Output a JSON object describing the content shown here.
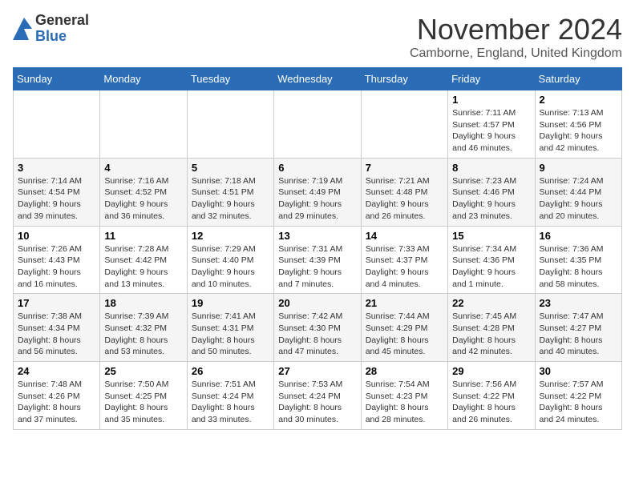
{
  "logo": {
    "general": "General",
    "blue": "Blue"
  },
  "header": {
    "month": "November 2024",
    "location": "Camborne, England, United Kingdom"
  },
  "weekdays": [
    "Sunday",
    "Monday",
    "Tuesday",
    "Wednesday",
    "Thursday",
    "Friday",
    "Saturday"
  ],
  "weeks": [
    [
      {
        "day": "",
        "info": ""
      },
      {
        "day": "",
        "info": ""
      },
      {
        "day": "",
        "info": ""
      },
      {
        "day": "",
        "info": ""
      },
      {
        "day": "",
        "info": ""
      },
      {
        "day": "1",
        "info": "Sunrise: 7:11 AM\nSunset: 4:57 PM\nDaylight: 9 hours and 46 minutes."
      },
      {
        "day": "2",
        "info": "Sunrise: 7:13 AM\nSunset: 4:56 PM\nDaylight: 9 hours and 42 minutes."
      }
    ],
    [
      {
        "day": "3",
        "info": "Sunrise: 7:14 AM\nSunset: 4:54 PM\nDaylight: 9 hours and 39 minutes."
      },
      {
        "day": "4",
        "info": "Sunrise: 7:16 AM\nSunset: 4:52 PM\nDaylight: 9 hours and 36 minutes."
      },
      {
        "day": "5",
        "info": "Sunrise: 7:18 AM\nSunset: 4:51 PM\nDaylight: 9 hours and 32 minutes."
      },
      {
        "day": "6",
        "info": "Sunrise: 7:19 AM\nSunset: 4:49 PM\nDaylight: 9 hours and 29 minutes."
      },
      {
        "day": "7",
        "info": "Sunrise: 7:21 AM\nSunset: 4:48 PM\nDaylight: 9 hours and 26 minutes."
      },
      {
        "day": "8",
        "info": "Sunrise: 7:23 AM\nSunset: 4:46 PM\nDaylight: 9 hours and 23 minutes."
      },
      {
        "day": "9",
        "info": "Sunrise: 7:24 AM\nSunset: 4:44 PM\nDaylight: 9 hours and 20 minutes."
      }
    ],
    [
      {
        "day": "10",
        "info": "Sunrise: 7:26 AM\nSunset: 4:43 PM\nDaylight: 9 hours and 16 minutes."
      },
      {
        "day": "11",
        "info": "Sunrise: 7:28 AM\nSunset: 4:42 PM\nDaylight: 9 hours and 13 minutes."
      },
      {
        "day": "12",
        "info": "Sunrise: 7:29 AM\nSunset: 4:40 PM\nDaylight: 9 hours and 10 minutes."
      },
      {
        "day": "13",
        "info": "Sunrise: 7:31 AM\nSunset: 4:39 PM\nDaylight: 9 hours and 7 minutes."
      },
      {
        "day": "14",
        "info": "Sunrise: 7:33 AM\nSunset: 4:37 PM\nDaylight: 9 hours and 4 minutes."
      },
      {
        "day": "15",
        "info": "Sunrise: 7:34 AM\nSunset: 4:36 PM\nDaylight: 9 hours and 1 minute."
      },
      {
        "day": "16",
        "info": "Sunrise: 7:36 AM\nSunset: 4:35 PM\nDaylight: 8 hours and 58 minutes."
      }
    ],
    [
      {
        "day": "17",
        "info": "Sunrise: 7:38 AM\nSunset: 4:34 PM\nDaylight: 8 hours and 56 minutes."
      },
      {
        "day": "18",
        "info": "Sunrise: 7:39 AM\nSunset: 4:32 PM\nDaylight: 8 hours and 53 minutes."
      },
      {
        "day": "19",
        "info": "Sunrise: 7:41 AM\nSunset: 4:31 PM\nDaylight: 8 hours and 50 minutes."
      },
      {
        "day": "20",
        "info": "Sunrise: 7:42 AM\nSunset: 4:30 PM\nDaylight: 8 hours and 47 minutes."
      },
      {
        "day": "21",
        "info": "Sunrise: 7:44 AM\nSunset: 4:29 PM\nDaylight: 8 hours and 45 minutes."
      },
      {
        "day": "22",
        "info": "Sunrise: 7:45 AM\nSunset: 4:28 PM\nDaylight: 8 hours and 42 minutes."
      },
      {
        "day": "23",
        "info": "Sunrise: 7:47 AM\nSunset: 4:27 PM\nDaylight: 8 hours and 40 minutes."
      }
    ],
    [
      {
        "day": "24",
        "info": "Sunrise: 7:48 AM\nSunset: 4:26 PM\nDaylight: 8 hours and 37 minutes."
      },
      {
        "day": "25",
        "info": "Sunrise: 7:50 AM\nSunset: 4:25 PM\nDaylight: 8 hours and 35 minutes."
      },
      {
        "day": "26",
        "info": "Sunrise: 7:51 AM\nSunset: 4:24 PM\nDaylight: 8 hours and 33 minutes."
      },
      {
        "day": "27",
        "info": "Sunrise: 7:53 AM\nSunset: 4:24 PM\nDaylight: 8 hours and 30 minutes."
      },
      {
        "day": "28",
        "info": "Sunrise: 7:54 AM\nSunset: 4:23 PM\nDaylight: 8 hours and 28 minutes."
      },
      {
        "day": "29",
        "info": "Sunrise: 7:56 AM\nSunset: 4:22 PM\nDaylight: 8 hours and 26 minutes."
      },
      {
        "day": "30",
        "info": "Sunrise: 7:57 AM\nSunset: 4:22 PM\nDaylight: 8 hours and 24 minutes."
      }
    ]
  ]
}
